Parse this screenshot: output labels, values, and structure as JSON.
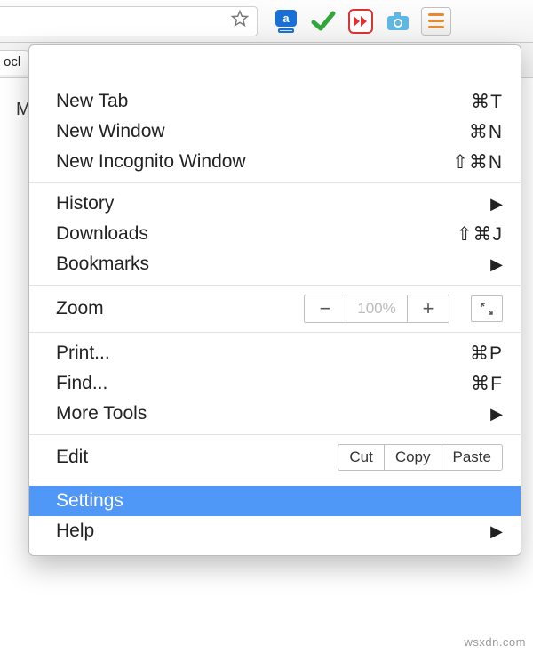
{
  "toolbar": {
    "hamburger_name": "main-menu"
  },
  "tab": {
    "fragment_text": "ocl"
  },
  "page": {
    "visible_letter": "M"
  },
  "menu": {
    "new_tab": {
      "label": "New Tab",
      "shortcut": "⌘T"
    },
    "new_window": {
      "label": "New Window",
      "shortcut": "⌘N"
    },
    "new_incognito": {
      "label": "New Incognito Window",
      "shortcut": "⇧⌘N"
    },
    "history": {
      "label": "History"
    },
    "downloads": {
      "label": "Downloads",
      "shortcut": "⇧⌘J"
    },
    "bookmarks": {
      "label": "Bookmarks"
    },
    "zoom": {
      "label": "Zoom",
      "value": "100%"
    },
    "print": {
      "label": "Print...",
      "shortcut": "⌘P"
    },
    "find": {
      "label": "Find...",
      "shortcut": "⌘F"
    },
    "more_tools": {
      "label": "More Tools"
    },
    "edit": {
      "label": "Edit",
      "cut": "Cut",
      "copy": "Copy",
      "paste": "Paste"
    },
    "settings": {
      "label": "Settings"
    },
    "help": {
      "label": "Help"
    }
  },
  "watermark": "wsxdn.com"
}
